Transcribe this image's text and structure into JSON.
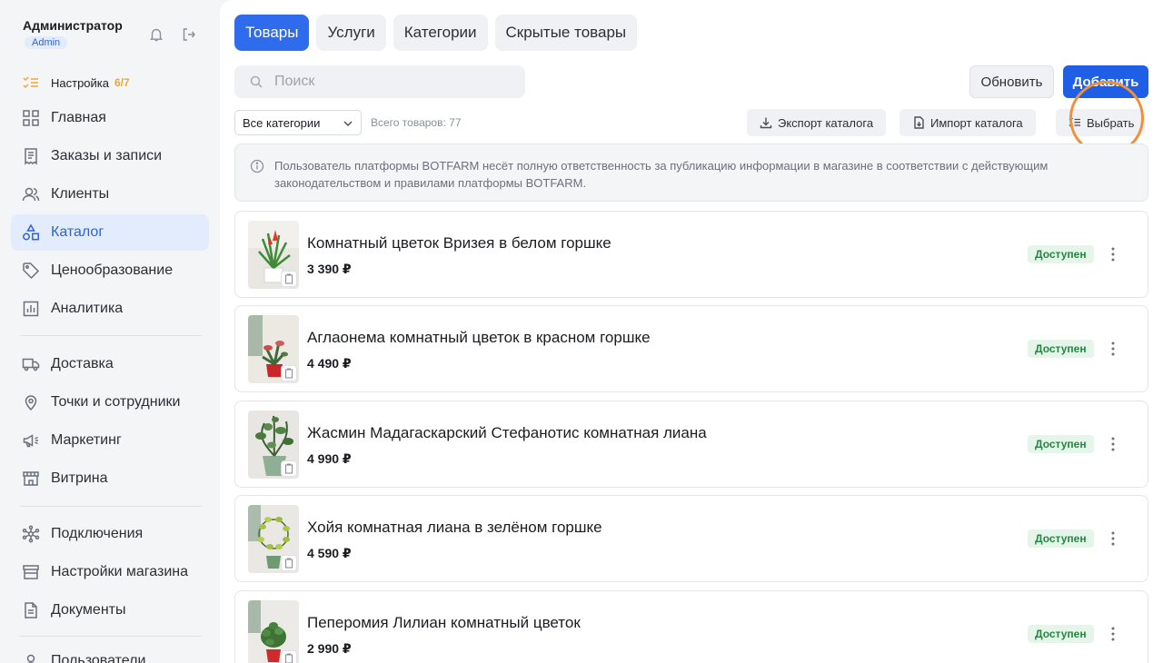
{
  "profile": {
    "name": "Администратор",
    "role": "Admin"
  },
  "setup": {
    "label": "Настройка",
    "count": "6/7"
  },
  "sidebar": {
    "items": [
      {
        "label": "Главная",
        "icon": "grid-icon"
      },
      {
        "label": "Заказы и записи",
        "icon": "receipt-icon"
      },
      {
        "label": "Клиенты",
        "icon": "users-icon"
      },
      {
        "label": "Каталог",
        "icon": "shapes-icon",
        "active": true
      },
      {
        "label": "Ценообразование",
        "icon": "tag-icon"
      },
      {
        "label": "Аналитика",
        "icon": "chart-icon"
      },
      {
        "label": "Доставка",
        "icon": "truck-icon"
      },
      {
        "label": "Точки и сотрудники",
        "icon": "pin-icon"
      },
      {
        "label": "Маркетинг",
        "icon": "megaphone-icon"
      },
      {
        "label": "Витрина",
        "icon": "storefront-icon"
      },
      {
        "label": "Подключения",
        "icon": "network-icon"
      },
      {
        "label": "Настройки магазина",
        "icon": "store-settings-icon"
      },
      {
        "label": "Документы",
        "icon": "document-icon"
      },
      {
        "label": "Пользователи",
        "icon": "user-icon"
      }
    ]
  },
  "tabs": [
    "Товары",
    "Услуги",
    "Категории",
    "Скрытые товары"
  ],
  "search": {
    "placeholder": "Поиск"
  },
  "toolbar": {
    "refresh_label": "Обновить",
    "add_label": "Добавить",
    "category_select": "Все категории",
    "total_label": "Всего товаров: 77",
    "export_label": "Экспорт каталога",
    "import_label": "Импорт каталога",
    "select_label": "Выбрать"
  },
  "notice": "Пользователь платформы BOTFARM несёт полную ответственность за публикацию информации в магазине в соответствии с действующим законодательством и правилами платформы BOTFARM.",
  "products": [
    {
      "title": "Комнатный цветок Вризея в белом горшке",
      "price": "3 390 ₽",
      "status": "Доступен"
    },
    {
      "title": "Аглаонема комнатный цветок в красном горшке",
      "price": "4 490 ₽",
      "status": "Доступен"
    },
    {
      "title": "Жасмин Мадагаскарский Стефанотис комнатная лиана",
      "price": "4 990 ₽",
      "status": "Доступен"
    },
    {
      "title": "Хойя комнатная лиана в зелёном горшке",
      "price": "4 590 ₽",
      "status": "Доступен"
    },
    {
      "title": "Пеперомия Лилиан комнатный цветок",
      "price": "2 990 ₽",
      "status": "Доступен"
    }
  ],
  "colors": {
    "accent": "#2f6bed",
    "active_bg": "#e3ecfc",
    "status_green": "#22883f",
    "setup_orange": "#e9a93a",
    "highlight": "#f0903a"
  }
}
